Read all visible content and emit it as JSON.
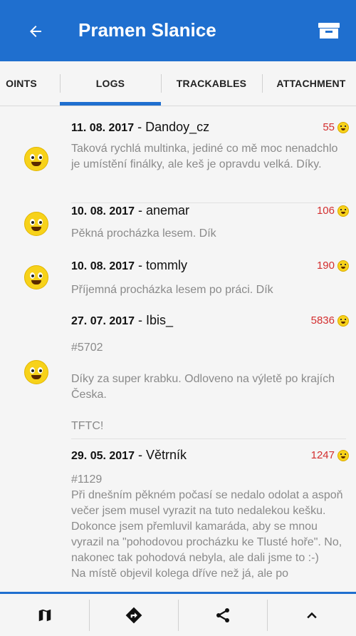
{
  "appbar": {
    "title": "Pramen Slanice",
    "back_icon": "arrow-left-icon",
    "action_icon": "box-icon"
  },
  "tabs": [
    {
      "label": "OINTS"
    },
    {
      "label": "LOGS"
    },
    {
      "label": "TRACKABLES"
    },
    {
      "label": "ATTACHMENT"
    }
  ],
  "active_tab": "LOGS",
  "logs": [
    {
      "date": "11. 08. 2017",
      "sep": " - ",
      "user": "Dandoy_cz",
      "count": "55",
      "text": "Taková rychlá multinka, jediné co mě moc nenadchlo je umístění finálky, ale keš je opravdu velká. Díky."
    },
    {
      "date": "10. 08. 2017",
      "sep": " - ",
      "user": "anemar",
      "count": "106",
      "text": "Pěkná procházka lesem. Dík"
    },
    {
      "date": "10. 08. 2017",
      "sep": " - ",
      "user": "tommly",
      "count": "190",
      "text": "Příjemná procházka lesem po práci. Dík"
    },
    {
      "date": "27. 07. 2017",
      "sep": " - ",
      "user": "Ibis_",
      "count": "5836",
      "text": "#5702\n\nDíky za super krabku. Odloveno na výletě po krajích Česka.\n\nTFTC!"
    },
    {
      "date": "29. 05. 2017",
      "sep": " - ",
      "user": "Větrník",
      "count": "1247",
      "text": "#1129\nPři dnešním pěkném počasí se nedalo odolat a aspoň večer jsem musel vyrazit na tuto nedalekou kešku. Dokonce jsem přemluvil kamaráda, aby se mnou vyrazil na \"pohodovou procházku ke Tlusté hoře\". No, nakonec tak pohodová nebyla, ale dali jsme to :-)\nNa místě objevil kolega dříve než já, ale po"
    }
  ],
  "bottom_bar": [
    {
      "icon": "map-icon"
    },
    {
      "icon": "navigate-icon"
    },
    {
      "icon": "share-icon"
    },
    {
      "icon": "chevron-up-icon"
    }
  ],
  "colors": {
    "primary": "#1f6fcf",
    "count": "#d32f2f",
    "text_muted": "#8a8a8a"
  }
}
